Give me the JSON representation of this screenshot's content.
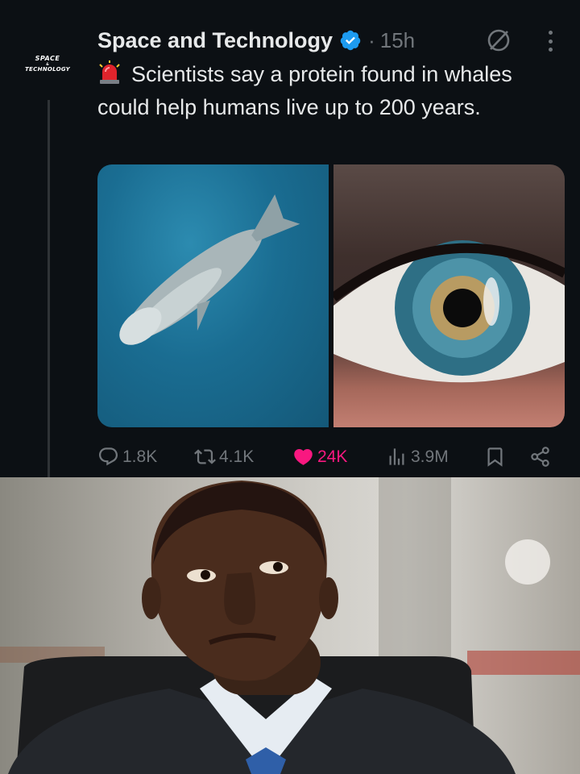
{
  "post": {
    "author_name": "Space and Technology",
    "avatar_text": [
      "SPACE",
      "&",
      "TECHNOLOGY"
    ],
    "separator": "·",
    "timestamp": "15h",
    "text": "Scientists say a protein found in whales could help humans live up to 200 years.",
    "media": [
      {
        "label": "whale-photo"
      },
      {
        "label": "eye-closeup-photo"
      }
    ],
    "stats": {
      "replies": "1.8K",
      "reposts": "4.1K",
      "likes": "24K",
      "views": "3.9M"
    }
  },
  "colors": {
    "background": "#0c1014",
    "text": "#e7e9ea",
    "muted": "#71767b",
    "verified": "#1d9bf0",
    "like": "#f91880"
  },
  "icons": [
    "siren-emoji",
    "verified-badge-icon",
    "grok-icon",
    "more-icon",
    "reply-icon",
    "repost-icon",
    "heart-icon",
    "views-icon",
    "bookmark-icon",
    "share-icon"
  ]
}
